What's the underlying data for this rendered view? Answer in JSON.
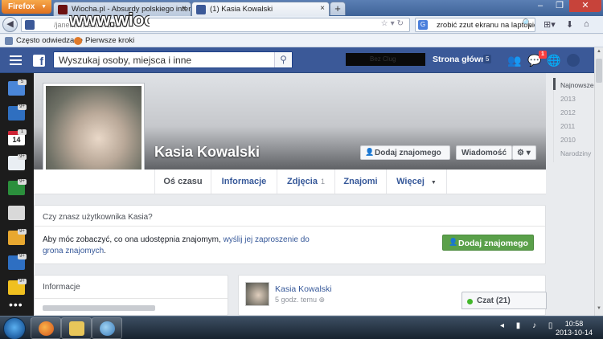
{
  "browser": {
    "menu_label": "Firefox",
    "tabs": [
      {
        "label": "Wiocha.pl - Absurdy polskiego intern..."
      },
      {
        "label": "(1) Kasia Kowalski"
      }
    ],
    "new_tab_label": "+",
    "address": "/janekowalski.1426876",
    "search_value": "zrobić zzut ekranu na laptopie",
    "bookmarks": [
      {
        "label": "Często odwiedzane"
      },
      {
        "label": "Pierwsze kroki"
      }
    ],
    "watermark": "www.wiocha.pl"
  },
  "facebook": {
    "search_placeholder": "Wyszukaj osoby, miejsca i inne",
    "redacted_text": "Bez Clug",
    "home_label": "Strona główna",
    "home_count": "5",
    "notification_badge": "1",
    "brand_color": "#3b5998"
  },
  "profile": {
    "name": "Kasia Kowalski",
    "add_friend_label": "Dodaj znajomego",
    "message_label": "Wiadomość",
    "tabs": [
      {
        "label": "Oś czasu"
      },
      {
        "label": "Informacje"
      },
      {
        "label": "Zdjęcia",
        "count": "1"
      },
      {
        "label": "Znajomi"
      },
      {
        "label": "Więcej"
      }
    ]
  },
  "timeline_years": [
    "Najnowsze",
    "2013",
    "2012",
    "2011",
    "2010",
    "Narodziny"
  ],
  "know_panel": {
    "question": "Czy znasz użytkownika Kasia?",
    "text_before": "Aby móc zobaczyć, co ona udostępnia znajomym, ",
    "link_text": "wyślij jej zaproszenie do grona znajomych",
    "text_after": ".",
    "button_label": "Dodaj znajomego"
  },
  "info_panel": {
    "heading": "Informacje"
  },
  "post": {
    "author": "Kasia Kowalski",
    "time": "5 godz. temu"
  },
  "chat": {
    "label": "Czat (21)"
  },
  "dock_badges": [
    "5",
    "9+",
    "1",
    "9+",
    "9+",
    "9+",
    "9+",
    "9+"
  ],
  "taskbar": {
    "time": "10:58",
    "date": "2013-10-14"
  }
}
